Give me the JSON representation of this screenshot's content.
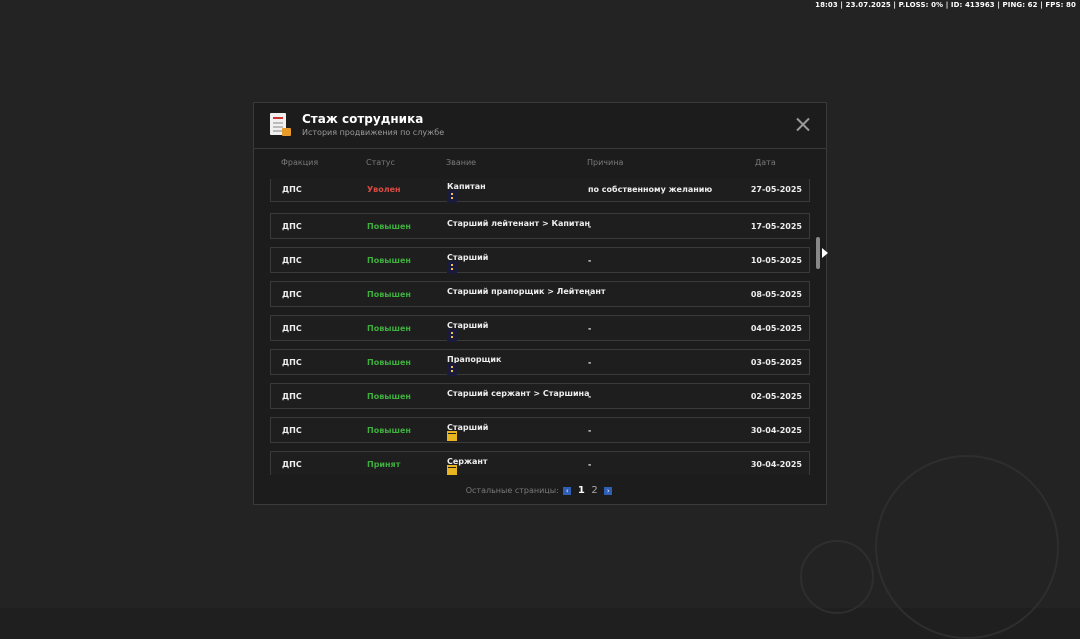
{
  "hud": {
    "text": "18:03 | 23.07.2025 | P.LOSS: 0% | ID: 413963 | PING: 62 | FPS: 80"
  },
  "modal": {
    "title": "Стаж сотрудника",
    "subtitle": "История продвижения по службе",
    "icon": "document-icon"
  },
  "columns": {
    "faction": "Фракция",
    "status": "Статус",
    "rank": "Звание",
    "reason": "Причина",
    "date": "Дата"
  },
  "rows": [
    {
      "faction": "ДПС",
      "status": "Уволен",
      "status_type": "fired",
      "rank": "Капитан",
      "rank_icon": "dark",
      "reason": "по собственному желанию",
      "date": "27-05-2025"
    },
    {
      "faction": "ДПС",
      "status": "Повышен",
      "status_type": "up",
      "rank": "Старший лейтенант > Капитан",
      "rank_icon": "none",
      "reason": "-",
      "date": "17-05-2025"
    },
    {
      "faction": "ДПС",
      "status": "Повышен",
      "status_type": "up",
      "rank": "Старший",
      "rank_icon": "dark",
      "reason": "-",
      "date": "10-05-2025"
    },
    {
      "faction": "ДПС",
      "status": "Повышен",
      "status_type": "up",
      "rank": "Старший прапорщик > Лейтенант",
      "rank_icon": "none",
      "reason": "-",
      "date": "08-05-2025"
    },
    {
      "faction": "ДПС",
      "status": "Повышен",
      "status_type": "up",
      "rank": "Старший",
      "rank_icon": "dark",
      "reason": "-",
      "date": "04-05-2025"
    },
    {
      "faction": "ДПС",
      "status": "Повышен",
      "status_type": "up",
      "rank": "Прапорщик",
      "rank_icon": "dark",
      "reason": "-",
      "date": "03-05-2025"
    },
    {
      "faction": "ДПС",
      "status": "Повышен",
      "status_type": "up",
      "rank": "Старший сержант > Старшина",
      "rank_icon": "none",
      "reason": "-",
      "date": "02-05-2025"
    },
    {
      "faction": "ДПС",
      "status": "Повышен",
      "status_type": "up",
      "rank": "Старший",
      "rank_icon": "gold",
      "reason": "-",
      "date": "30-04-2025"
    },
    {
      "faction": "ДПС",
      "status": "Принят",
      "status_type": "up",
      "rank": "Сержант",
      "rank_icon": "gold",
      "reason": "-",
      "date": "30-04-2025"
    }
  ],
  "pager": {
    "label": "Остальные страницы:",
    "pages": [
      "1",
      "2"
    ],
    "current": "1",
    "prev": "‹",
    "next": "›"
  }
}
